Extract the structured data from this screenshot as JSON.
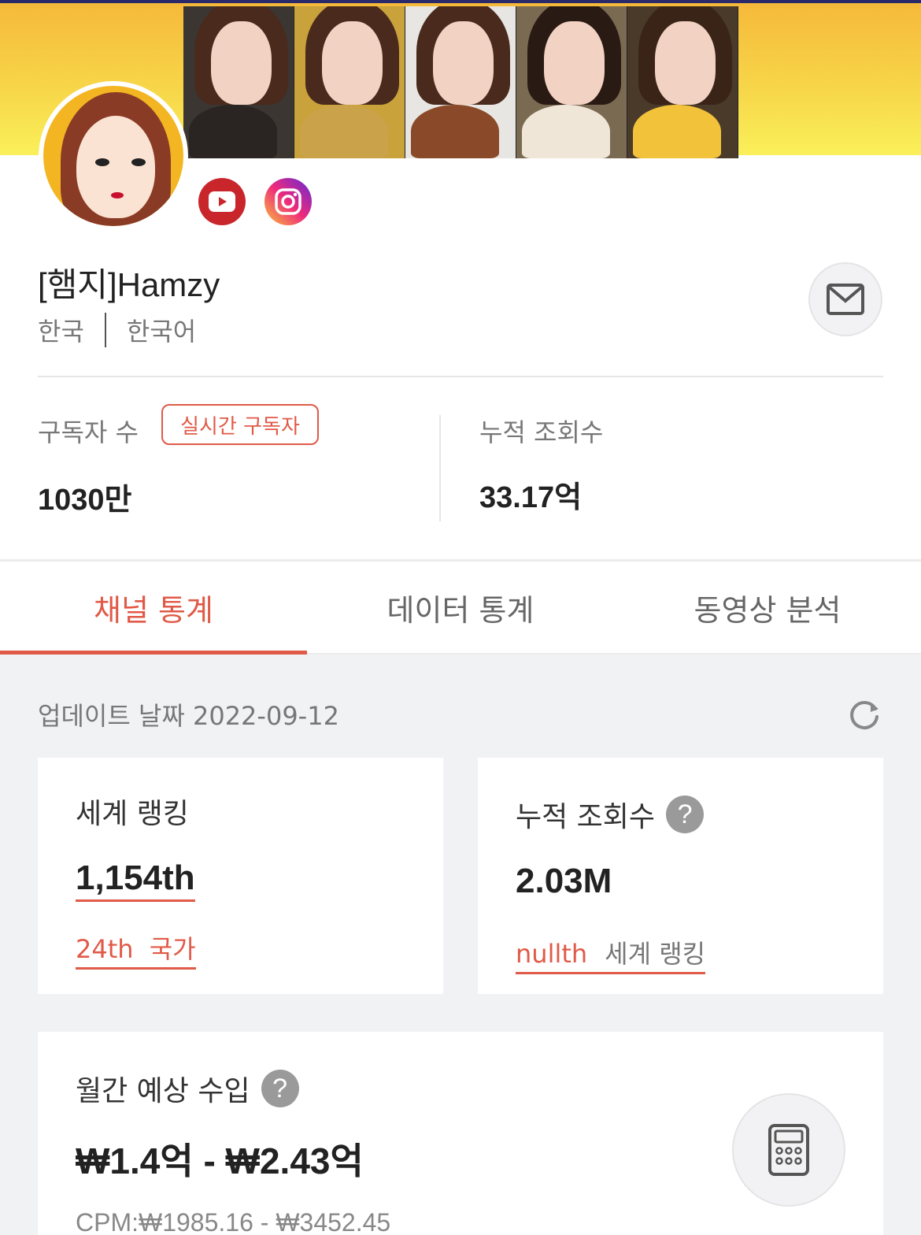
{
  "channel": {
    "name": "[햄지]Hamzy",
    "country": "한국",
    "language": "한국어"
  },
  "stats": {
    "subscribers_label": "구독자 수",
    "live_badge": "실시간 구독자",
    "subscribers_value": "1030만",
    "views_label": "누적 조회수",
    "views_value": "33.17억"
  },
  "tabs": [
    {
      "label": "채널 통계",
      "active": true
    },
    {
      "label": "데이터 통계",
      "active": false
    },
    {
      "label": "동영상 분석",
      "active": false
    }
  ],
  "update": {
    "text": "업데이트 날짜 2022-09-12"
  },
  "world_rank_card": {
    "title": "세계 랭킹",
    "value": "1,154th",
    "country_rank": "24th",
    "country_label": "국가"
  },
  "views_card": {
    "title": "누적 조회수",
    "help": "?",
    "value": "2.03M",
    "rank": "nullth",
    "rank_label": "세계 랭킹"
  },
  "income_card": {
    "title": "월간 예상 수입",
    "help": "?",
    "value": "₩1.4억 - ₩2.43억",
    "cpm": "CPM:₩1985.16 - ₩3452.45"
  },
  "icons": {
    "youtube": "youtube-icon",
    "instagram": "instagram-icon",
    "mail": "mail-icon",
    "refresh": "refresh-icon",
    "calculator": "calculator-icon"
  },
  "colors": {
    "accent": "#e05a48",
    "youtube": "#c9262c",
    "banner": "#f7d84a"
  }
}
